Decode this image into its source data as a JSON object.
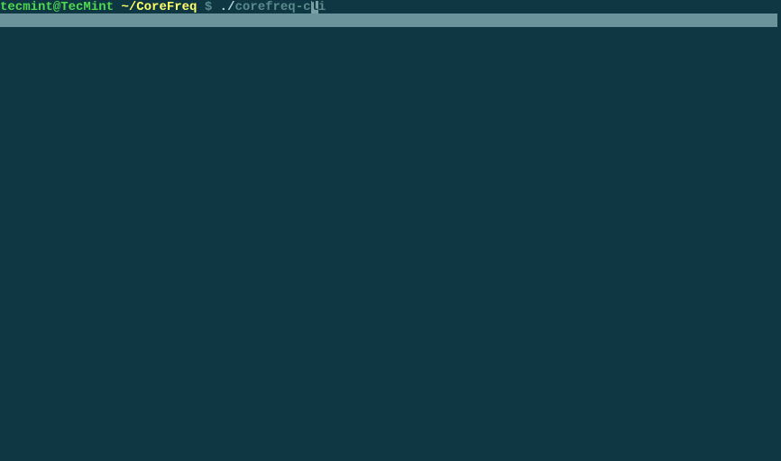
{
  "prompt": {
    "user_host": "tecmint@TecMint",
    "cwd": "~/CoreFreq",
    "symbol": "$",
    "typed": "./corefreq-c",
    "typed_prefix": "./",
    "typed_main": "corefreq-c",
    "cursor_char": "l",
    "completion_tail": "i"
  }
}
